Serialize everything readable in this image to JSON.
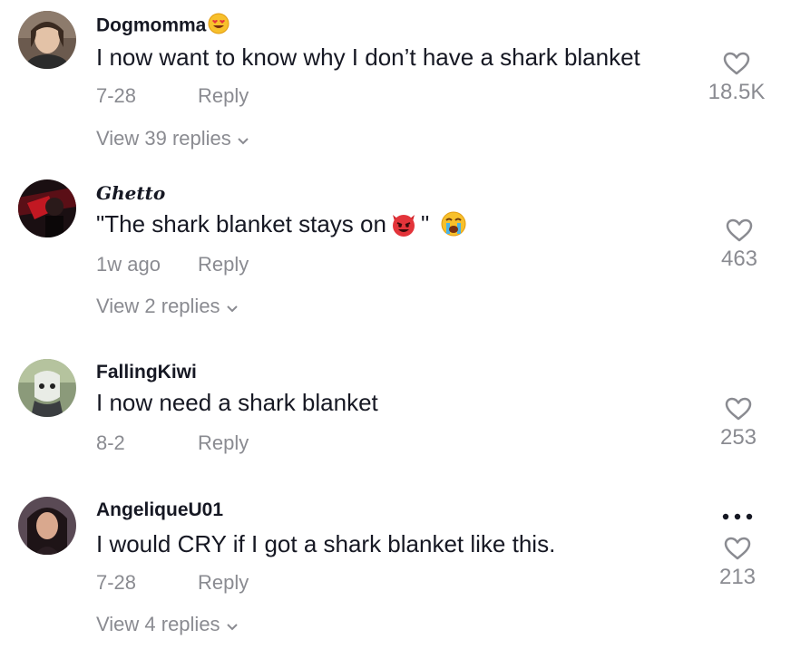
{
  "comments": [
    {
      "username": "Dogmomma",
      "username_emoji": "heart-eyes-emoji",
      "text": "I now want to know why I don’t have a shark blanket",
      "date": "7-28",
      "reply_label": "Reply",
      "likes": "18.5K",
      "view_replies": "View 39 replies"
    },
    {
      "username": "Ghetto",
      "text": "\"The shark blanket stays on",
      "text_end": "\"",
      "text_emojis": [
        "devil-emoji",
        "crying-emoji"
      ],
      "date": "1w ago",
      "reply_label": "Reply",
      "likes": "463",
      "view_replies": "View 2 replies"
    },
    {
      "username": "FallingKiwi",
      "text": "I now need a shark blanket",
      "date": "8-2",
      "reply_label": "Reply",
      "likes": "253"
    },
    {
      "username": "AngeliqueU01",
      "text": "I would CRY if I got a shark blanket like this.",
      "date": "7-28",
      "reply_label": "Reply",
      "likes": "213",
      "view_replies": "View 4 replies",
      "more_icon": "more-dots-icon"
    }
  ],
  "colors": {
    "text_primary": "#161823",
    "text_secondary": "#8a8b91"
  }
}
